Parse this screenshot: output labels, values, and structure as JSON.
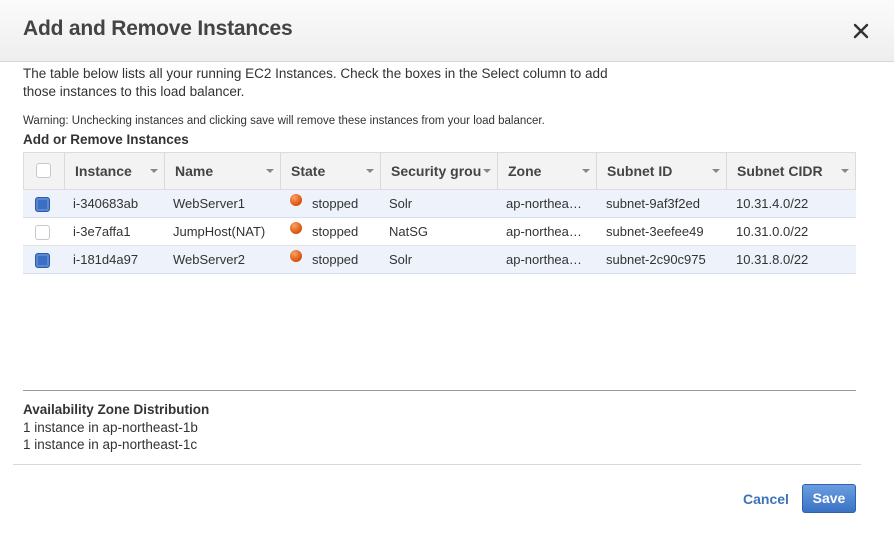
{
  "dialog": {
    "title": "Add and Remove Instances",
    "intro": "The table below lists all your running EC2 Instances. Check the boxes in the Select column to add those instances to this load balancer.",
    "warning": "Warning: Unchecking instances and clicking save will remove these instances from your load balancer.",
    "section_title": "Add or Remove Instances"
  },
  "table": {
    "columns": [
      "Instance",
      "Name",
      "State",
      "Security grou",
      "Zone",
      "Subnet ID",
      "Subnet CIDR"
    ],
    "rows": [
      {
        "checked": true,
        "instance": "i-340683ab",
        "name": "WebServer1",
        "state": "stopped",
        "security_group": "Solr",
        "zone": "ap-northea…",
        "subnet_id": "subnet-9af3f2ed",
        "subnet_cidr": "10.31.4.0/22"
      },
      {
        "checked": false,
        "instance": "i-3e7affa1",
        "name": "JumpHost(NAT)",
        "state": "stopped",
        "security_group": "NatSG",
        "zone": "ap-northea…",
        "subnet_id": "subnet-3eefee49",
        "subnet_cidr": "10.31.0.0/22"
      },
      {
        "checked": true,
        "instance": "i-181d4a97",
        "name": "WebServer2",
        "state": "stopped",
        "security_group": "Solr",
        "zone": "ap-northea…",
        "subnet_id": "subnet-2c90c975",
        "subnet_cidr": "10.31.8.0/22"
      }
    ]
  },
  "distribution": {
    "title": "Availability Zone Distribution",
    "lines": [
      "1 instance in ap-northeast-1b",
      "1 instance in ap-northeast-1c"
    ]
  },
  "footer": {
    "cancel_label": "Cancel",
    "save_label": "Save"
  },
  "colors": {
    "accent": "#3d72b8",
    "save_button": "#4a80cf",
    "stopped_status": "#e25a12",
    "selected_row": "#edf2fb"
  }
}
